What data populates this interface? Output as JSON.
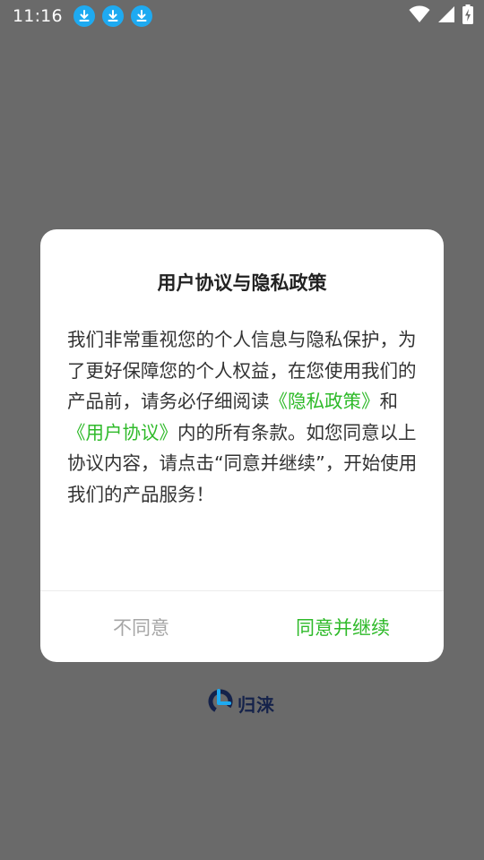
{
  "status_bar": {
    "time": "11:16",
    "download_icons": [
      "download-icon",
      "download-icon",
      "download-icon"
    ],
    "right_icons": [
      "wifi-icon",
      "signal-icon",
      "battery-charging-icon"
    ]
  },
  "dialog": {
    "title": "用户协议与隐私政策",
    "body": {
      "part1": "我们非常重视您的个人信息与隐私保护，为了更好保障您的个人权益，在您使用我们的产品前，请务必仔细阅读",
      "privacy_link": "《隐私政策》",
      "and": "和",
      "user_agreement_link": "《用户协议》",
      "part2": "内的所有条款。如您同意以上协议内容，请点击“同意并继续”，开始使用我们的产品服务！"
    },
    "disagree_label": "不同意",
    "agree_label": "同意并继续"
  },
  "logo": {
    "text": "归涞"
  },
  "colors": {
    "overlay": "#6a6a6a",
    "accent_green": "#2fba2a",
    "disagree_gray": "#a6a6a6",
    "download_blue": "#1eaaf1",
    "logo_navy": "#15224a"
  }
}
